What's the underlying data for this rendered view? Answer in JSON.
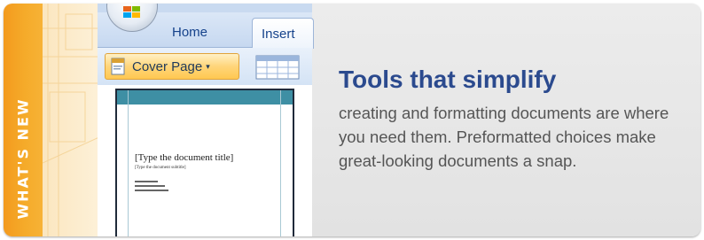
{
  "strip": {
    "label": "WHAT'S NEW",
    "color": "#f5a623"
  },
  "ribbon": {
    "tabs": [
      {
        "label": "Home"
      },
      {
        "label": "Insert"
      }
    ],
    "cover_button": {
      "label": "Cover Page",
      "dropdown_glyph": "▾"
    }
  },
  "preview": {
    "doc_title": "[Type the document title]",
    "doc_subtitle": "[Type the document subtitle]"
  },
  "promo": {
    "headline": "Tools that simplify",
    "body": "creating and formatting documents are where you need them. Preformatted choices make great-looking documents a snap.",
    "headline_color": "#2b4a8e",
    "body_color": "#555555"
  },
  "icons": [
    "office-button-icon",
    "cover-page-icon",
    "table-icon"
  ]
}
